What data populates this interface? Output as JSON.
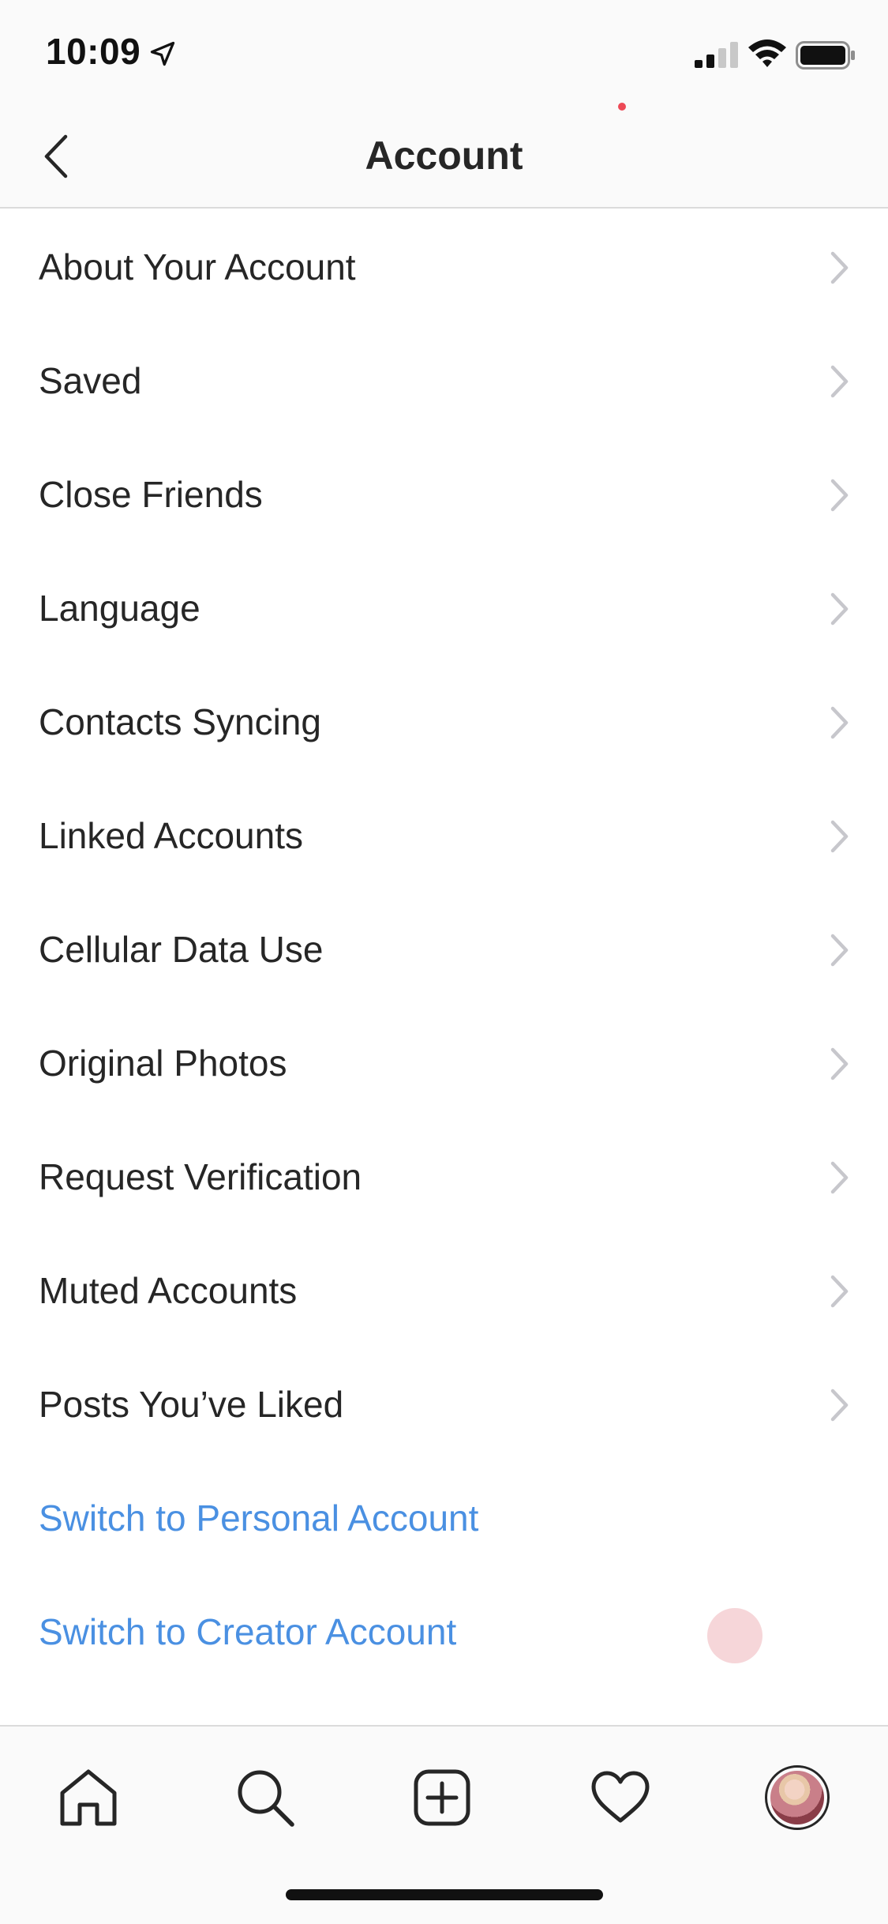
{
  "status_bar": {
    "time": "10:09",
    "location_icon": "location-arrow-icon",
    "signal_icon": "cellular-signal-icon",
    "wifi_icon": "wifi-icon",
    "battery_icon": "battery-icon"
  },
  "header": {
    "title": "Account",
    "back_icon": "chevron-left-icon"
  },
  "menu": {
    "items": [
      {
        "label": "About Your Account"
      },
      {
        "label": "Saved"
      },
      {
        "label": "Close Friends"
      },
      {
        "label": "Language"
      },
      {
        "label": "Contacts Syncing"
      },
      {
        "label": "Linked Accounts"
      },
      {
        "label": "Cellular Data Use"
      },
      {
        "label": "Original Photos"
      },
      {
        "label": "Request Verification"
      },
      {
        "label": "Muted Accounts"
      },
      {
        "label": "Posts You’ve Liked"
      }
    ],
    "links": [
      {
        "label": "Switch to Personal Account"
      },
      {
        "label": "Switch to Creator Account"
      }
    ]
  },
  "tab_bar": {
    "tabs": [
      {
        "icon": "home-icon"
      },
      {
        "icon": "search-icon"
      },
      {
        "icon": "add-post-icon"
      },
      {
        "icon": "heart-icon"
      },
      {
        "icon": "profile-avatar"
      }
    ]
  },
  "colors": {
    "text": "#262626",
    "link": "#4a90e2",
    "chevron": "#c7c7cc",
    "divider": "#dbdbdb",
    "bar_background": "#fafafa",
    "notification_dot": "#ed4956"
  }
}
